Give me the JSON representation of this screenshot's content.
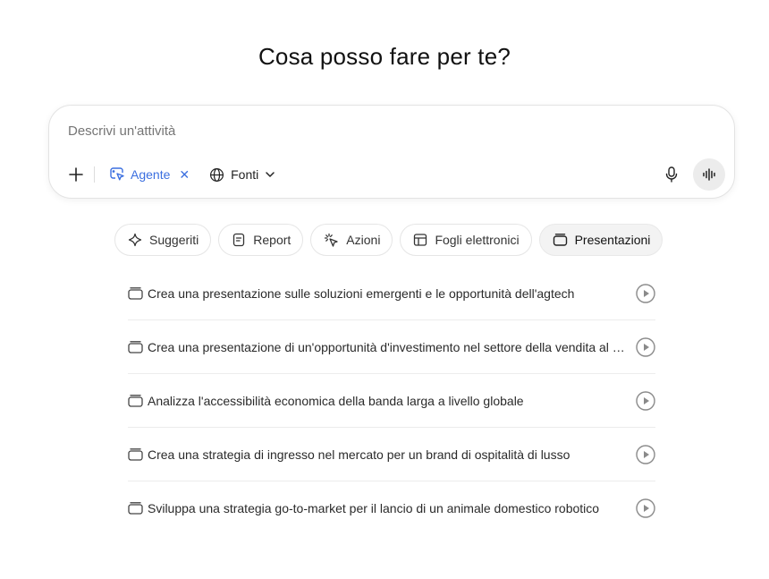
{
  "heading": "Cosa posso fare per te?",
  "composer": {
    "placeholder": "Descrivi un'attività",
    "agent_label": "Agente",
    "sources_label": "Fonti",
    "icons": [
      "plus-icon",
      "agent-cursor-icon",
      "close-icon",
      "globe-icon",
      "chevron-down-icon",
      "microphone-icon",
      "voice-waveform-icon"
    ]
  },
  "tabs": [
    {
      "label": "Suggeriti",
      "icon": "sparkle-icon"
    },
    {
      "label": "Report",
      "icon": "document-icon"
    },
    {
      "label": "Azioni",
      "icon": "click-icon"
    },
    {
      "label": "Fogli elettronici",
      "icon": "table-icon"
    },
    {
      "label": "Presentazioni",
      "icon": "slides-icon",
      "active": true
    }
  ],
  "suggestions": [
    "Crea una presentazione sulle soluzioni emergenti e le opportunità dell'agtech",
    "Crea una presentazione di un'opportunità d'investimento nel settore della vendita al dettaglio",
    "Analizza l'accessibilità economica della banda larga a livello globale",
    "Crea una strategia di ingresso nel mercato per un brand di ospitalità di lusso",
    "Sviluppa una strategia go-to-market per il lancio di un animale domestico robotico"
  ],
  "colors": {
    "accent": "#3b6fe0",
    "active_tab_bg": "#f3f3f3"
  }
}
